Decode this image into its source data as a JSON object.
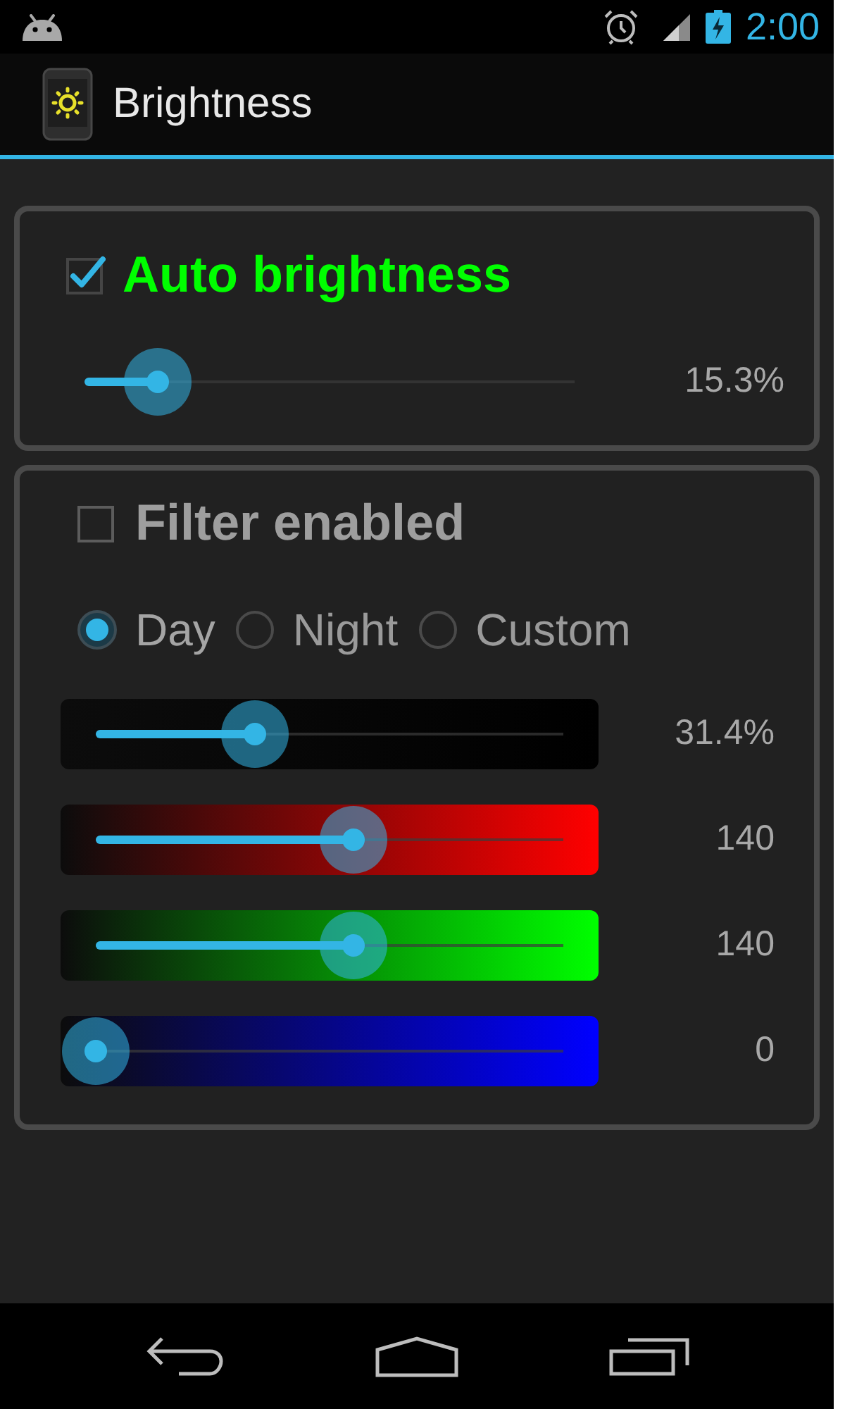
{
  "status_bar": {
    "time": "2:00"
  },
  "action_bar": {
    "title": "Brightness"
  },
  "auto_brightness": {
    "label": "Auto brightness",
    "checked": true,
    "slider": {
      "level": 0.15,
      "reading": "15.3%"
    }
  },
  "filter": {
    "label": "Filter enabled",
    "checked": false,
    "modes": [
      {
        "label": "Day",
        "selected": true
      },
      {
        "label": "Night",
        "selected": false
      },
      {
        "label": "Custom",
        "selected": false
      }
    ],
    "sliders": [
      {
        "color": "#000000",
        "level": 0.34,
        "reading": "31.4%"
      },
      {
        "color": "#ff0000",
        "level": 0.55,
        "reading": "140"
      },
      {
        "color": "#00ff00",
        "level": 0.55,
        "reading": "140"
      },
      {
        "color": "#0000ff",
        "level": 0,
        "reading": "0"
      }
    ]
  }
}
